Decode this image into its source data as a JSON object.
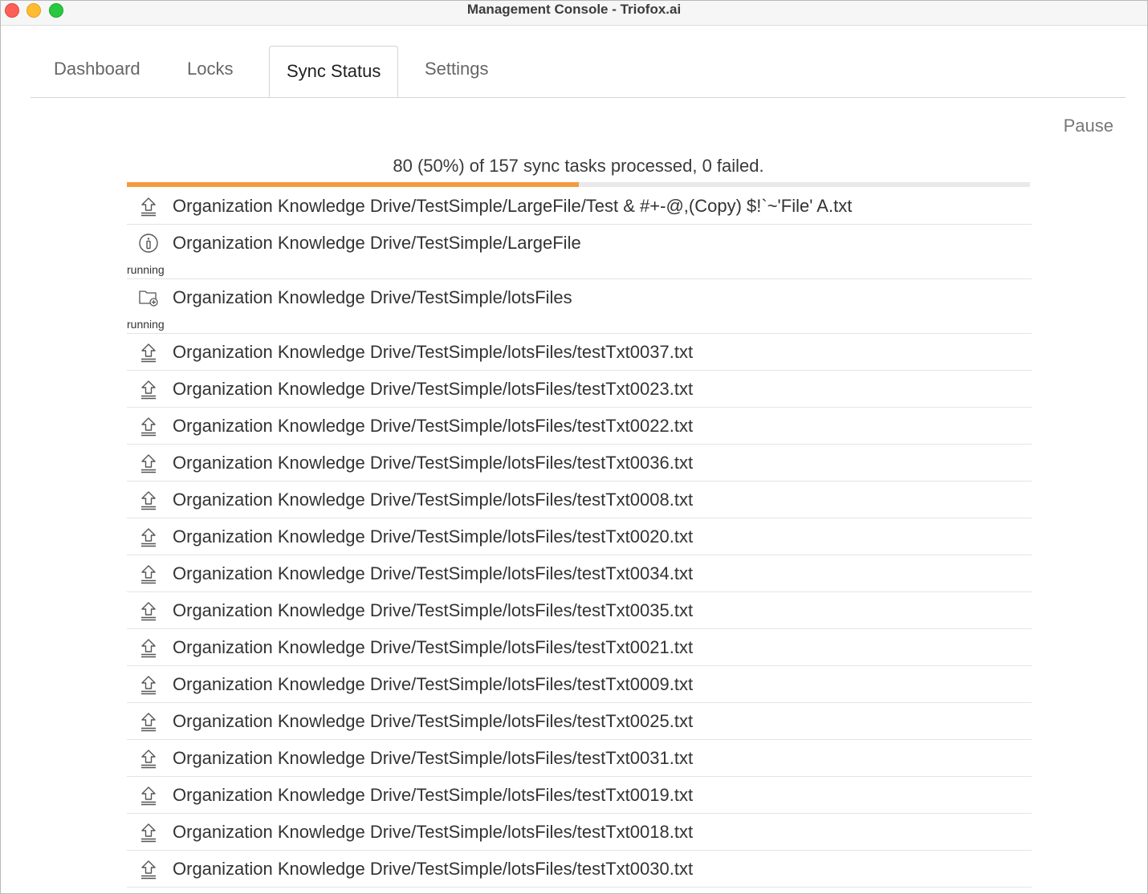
{
  "window": {
    "title": "Management Console - Triofox.ai"
  },
  "tabs": [
    {
      "label": "Dashboard"
    },
    {
      "label": "Locks"
    },
    {
      "label": "Sync Status",
      "active": true
    },
    {
      "label": "Settings"
    }
  ],
  "actions": {
    "pause_label": "Pause"
  },
  "sync": {
    "summary": "80 (50%) of 157 sync tasks processed, 0 failed.",
    "progress_fraction": 0.5
  },
  "items": [
    {
      "icon": "upload-icon",
      "path": "Organization Knowledge Drive/TestSimple/LargeFile/Test & #+-@,(Copy) $!`~'File' A.txt",
      "status": ""
    },
    {
      "icon": "info-icon",
      "path": "Organization Knowledge Drive/TestSimple/LargeFile",
      "status": "running"
    },
    {
      "icon": "folder-add-icon",
      "path": "Organization Knowledge Drive/TestSimple/lotsFiles",
      "status": "running"
    },
    {
      "icon": "upload-icon",
      "path": "Organization Knowledge Drive/TestSimple/lotsFiles/testTxt0037.txt",
      "status": ""
    },
    {
      "icon": "upload-icon",
      "path": "Organization Knowledge Drive/TestSimple/lotsFiles/testTxt0023.txt",
      "status": ""
    },
    {
      "icon": "upload-icon",
      "path": "Organization Knowledge Drive/TestSimple/lotsFiles/testTxt0022.txt",
      "status": ""
    },
    {
      "icon": "upload-icon",
      "path": "Organization Knowledge Drive/TestSimple/lotsFiles/testTxt0036.txt",
      "status": ""
    },
    {
      "icon": "upload-icon",
      "path": "Organization Knowledge Drive/TestSimple/lotsFiles/testTxt0008.txt",
      "status": ""
    },
    {
      "icon": "upload-icon",
      "path": "Organization Knowledge Drive/TestSimple/lotsFiles/testTxt0020.txt",
      "status": ""
    },
    {
      "icon": "upload-icon",
      "path": "Organization Knowledge Drive/TestSimple/lotsFiles/testTxt0034.txt",
      "status": ""
    },
    {
      "icon": "upload-icon",
      "path": "Organization Knowledge Drive/TestSimple/lotsFiles/testTxt0035.txt",
      "status": ""
    },
    {
      "icon": "upload-icon",
      "path": "Organization Knowledge Drive/TestSimple/lotsFiles/testTxt0021.txt",
      "status": ""
    },
    {
      "icon": "upload-icon",
      "path": "Organization Knowledge Drive/TestSimple/lotsFiles/testTxt0009.txt",
      "status": ""
    },
    {
      "icon": "upload-icon",
      "path": "Organization Knowledge Drive/TestSimple/lotsFiles/testTxt0025.txt",
      "status": ""
    },
    {
      "icon": "upload-icon",
      "path": "Organization Knowledge Drive/TestSimple/lotsFiles/testTxt0031.txt",
      "status": ""
    },
    {
      "icon": "upload-icon",
      "path": "Organization Knowledge Drive/TestSimple/lotsFiles/testTxt0019.txt",
      "status": ""
    },
    {
      "icon": "upload-icon",
      "path": "Organization Knowledge Drive/TestSimple/lotsFiles/testTxt0018.txt",
      "status": ""
    },
    {
      "icon": "upload-icon",
      "path": "Organization Knowledge Drive/TestSimple/lotsFiles/testTxt0030.txt",
      "status": ""
    }
  ]
}
